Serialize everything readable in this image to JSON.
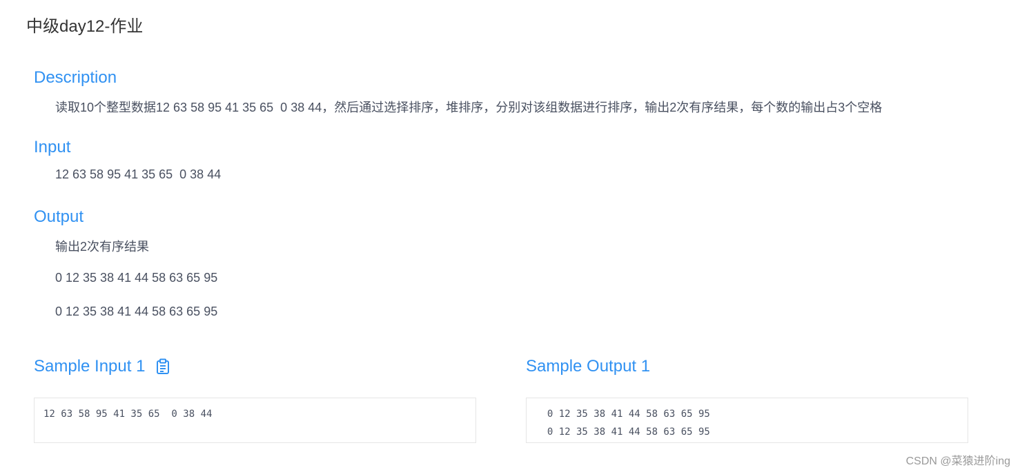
{
  "page": {
    "title": "中级day12-作业"
  },
  "sections": {
    "description": {
      "title": "Description",
      "text": "读取10个整型数据12 63 58 95 41 35 65  0 38 44，然后通过选择排序，堆排序，分别对该组数据进行排序，输出2次有序结果，每个数的输出占3个空格"
    },
    "input": {
      "title": "Input",
      "text": "12 63 58 95 41 35 65  0 38 44"
    },
    "output": {
      "title": "Output",
      "lines": [
        "输出2次有序结果",
        "0 12 35 38 41 44 58 63 65 95",
        "0 12 35 38 41 44 58 63 65 95"
      ]
    }
  },
  "samples": {
    "input": {
      "title": "Sample Input 1",
      "icon": "clipboard-icon",
      "content": "12 63 58 95 41 35 65  0 38 44"
    },
    "output": {
      "title": "Sample Output 1",
      "content": "  0 12 35 38 41 44 58 63 65 95\n  0 12 35 38 41 44 58 63 65 95"
    }
  },
  "watermark": "CSDN @菜猿进阶ing",
  "colors": {
    "accent": "#3091f2",
    "text": "#495060",
    "title": "#333333",
    "border": "#e5e5e5"
  }
}
